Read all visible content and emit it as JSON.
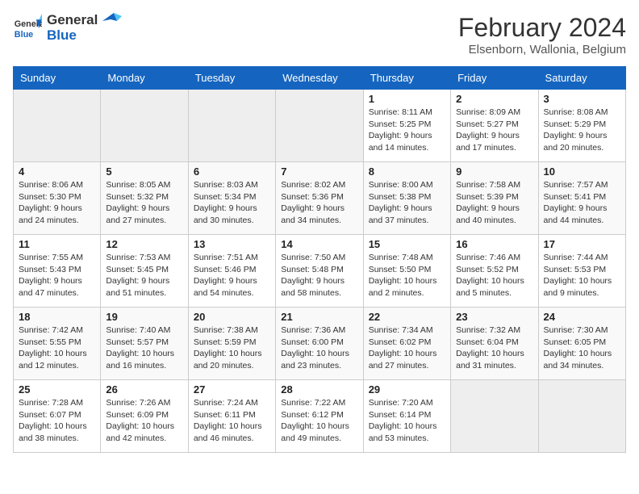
{
  "header": {
    "logo_general": "General",
    "logo_blue": "Blue",
    "main_title": "February 2024",
    "subtitle": "Elsenborn, Wallonia, Belgium"
  },
  "columns": [
    "Sunday",
    "Monday",
    "Tuesday",
    "Wednesday",
    "Thursday",
    "Friday",
    "Saturday"
  ],
  "weeks": [
    [
      {
        "day": "",
        "info": ""
      },
      {
        "day": "",
        "info": ""
      },
      {
        "day": "",
        "info": ""
      },
      {
        "day": "",
        "info": ""
      },
      {
        "day": "1",
        "info": "Sunrise: 8:11 AM\nSunset: 5:25 PM\nDaylight: 9 hours and 14 minutes."
      },
      {
        "day": "2",
        "info": "Sunrise: 8:09 AM\nSunset: 5:27 PM\nDaylight: 9 hours and 17 minutes."
      },
      {
        "day": "3",
        "info": "Sunrise: 8:08 AM\nSunset: 5:29 PM\nDaylight: 9 hours and 20 minutes."
      }
    ],
    [
      {
        "day": "4",
        "info": "Sunrise: 8:06 AM\nSunset: 5:30 PM\nDaylight: 9 hours and 24 minutes."
      },
      {
        "day": "5",
        "info": "Sunrise: 8:05 AM\nSunset: 5:32 PM\nDaylight: 9 hours and 27 minutes."
      },
      {
        "day": "6",
        "info": "Sunrise: 8:03 AM\nSunset: 5:34 PM\nDaylight: 9 hours and 30 minutes."
      },
      {
        "day": "7",
        "info": "Sunrise: 8:02 AM\nSunset: 5:36 PM\nDaylight: 9 hours and 34 minutes."
      },
      {
        "day": "8",
        "info": "Sunrise: 8:00 AM\nSunset: 5:38 PM\nDaylight: 9 hours and 37 minutes."
      },
      {
        "day": "9",
        "info": "Sunrise: 7:58 AM\nSunset: 5:39 PM\nDaylight: 9 hours and 40 minutes."
      },
      {
        "day": "10",
        "info": "Sunrise: 7:57 AM\nSunset: 5:41 PM\nDaylight: 9 hours and 44 minutes."
      }
    ],
    [
      {
        "day": "11",
        "info": "Sunrise: 7:55 AM\nSunset: 5:43 PM\nDaylight: 9 hours and 47 minutes."
      },
      {
        "day": "12",
        "info": "Sunrise: 7:53 AM\nSunset: 5:45 PM\nDaylight: 9 hours and 51 minutes."
      },
      {
        "day": "13",
        "info": "Sunrise: 7:51 AM\nSunset: 5:46 PM\nDaylight: 9 hours and 54 minutes."
      },
      {
        "day": "14",
        "info": "Sunrise: 7:50 AM\nSunset: 5:48 PM\nDaylight: 9 hours and 58 minutes."
      },
      {
        "day": "15",
        "info": "Sunrise: 7:48 AM\nSunset: 5:50 PM\nDaylight: 10 hours and 2 minutes."
      },
      {
        "day": "16",
        "info": "Sunrise: 7:46 AM\nSunset: 5:52 PM\nDaylight: 10 hours and 5 minutes."
      },
      {
        "day": "17",
        "info": "Sunrise: 7:44 AM\nSunset: 5:53 PM\nDaylight: 10 hours and 9 minutes."
      }
    ],
    [
      {
        "day": "18",
        "info": "Sunrise: 7:42 AM\nSunset: 5:55 PM\nDaylight: 10 hours and 12 minutes."
      },
      {
        "day": "19",
        "info": "Sunrise: 7:40 AM\nSunset: 5:57 PM\nDaylight: 10 hours and 16 minutes."
      },
      {
        "day": "20",
        "info": "Sunrise: 7:38 AM\nSunset: 5:59 PM\nDaylight: 10 hours and 20 minutes."
      },
      {
        "day": "21",
        "info": "Sunrise: 7:36 AM\nSunset: 6:00 PM\nDaylight: 10 hours and 23 minutes."
      },
      {
        "day": "22",
        "info": "Sunrise: 7:34 AM\nSunset: 6:02 PM\nDaylight: 10 hours and 27 minutes."
      },
      {
        "day": "23",
        "info": "Sunrise: 7:32 AM\nSunset: 6:04 PM\nDaylight: 10 hours and 31 minutes."
      },
      {
        "day": "24",
        "info": "Sunrise: 7:30 AM\nSunset: 6:05 PM\nDaylight: 10 hours and 34 minutes."
      }
    ],
    [
      {
        "day": "25",
        "info": "Sunrise: 7:28 AM\nSunset: 6:07 PM\nDaylight: 10 hours and 38 minutes."
      },
      {
        "day": "26",
        "info": "Sunrise: 7:26 AM\nSunset: 6:09 PM\nDaylight: 10 hours and 42 minutes."
      },
      {
        "day": "27",
        "info": "Sunrise: 7:24 AM\nSunset: 6:11 PM\nDaylight: 10 hours and 46 minutes."
      },
      {
        "day": "28",
        "info": "Sunrise: 7:22 AM\nSunset: 6:12 PM\nDaylight: 10 hours and 49 minutes."
      },
      {
        "day": "29",
        "info": "Sunrise: 7:20 AM\nSunset: 6:14 PM\nDaylight: 10 hours and 53 minutes."
      },
      {
        "day": "",
        "info": ""
      },
      {
        "day": "",
        "info": ""
      }
    ]
  ]
}
